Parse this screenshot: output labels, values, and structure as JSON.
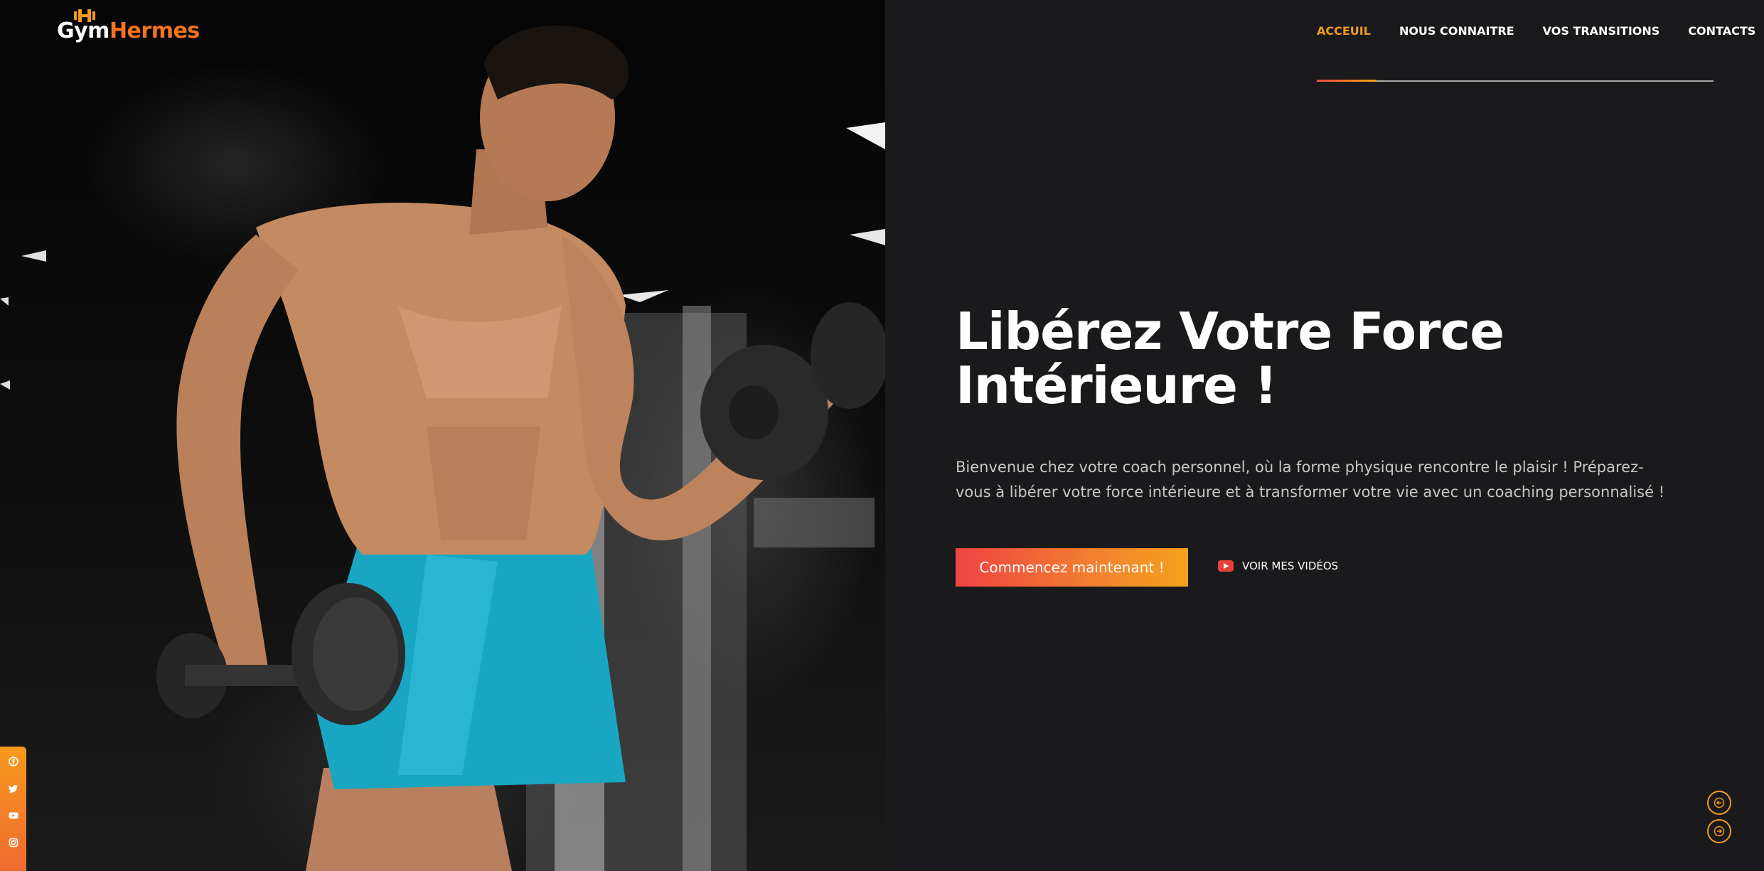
{
  "brand": {
    "name_part1": "Gym",
    "name_part2": "Hermes",
    "logo_icon": "dumbbell-icon"
  },
  "nav": {
    "items": [
      {
        "label": "ACCEUIL",
        "active": true
      },
      {
        "label": "NOUS CONNAITRE",
        "active": false
      },
      {
        "label": "VOS TRANSITIONS",
        "active": false
      },
      {
        "label": "CONTACTS",
        "active": false
      }
    ]
  },
  "hero": {
    "headline": "Libérez Votre Force Intérieure !",
    "intro": "Bienvenue chez votre coach personnel, où la forme physique rencontre le plaisir ! Préparez-vous à libérer votre force intérieure et à transformer votre vie avec un coaching personnalisé !",
    "cta_label": "Commencez maintenant !",
    "video_label": "VOIR MES VIDÉOS",
    "image_subject": "bodybuilder-lifting-dumbbells"
  },
  "social": {
    "icons": [
      "facebook-icon",
      "twitter-icon",
      "youtube-icon",
      "instagram-icon"
    ]
  },
  "slider": {
    "prev_icon": "arrow-left-icon",
    "next_icon": "arrow-right-icon"
  },
  "colors": {
    "background": "#1a1a1c",
    "accent_orange": "#f39a1d",
    "accent_red": "#ef4343",
    "brand_orange": "#f5741f",
    "cta_gradient": [
      "#ef4343",
      "#f5a11b"
    ]
  }
}
